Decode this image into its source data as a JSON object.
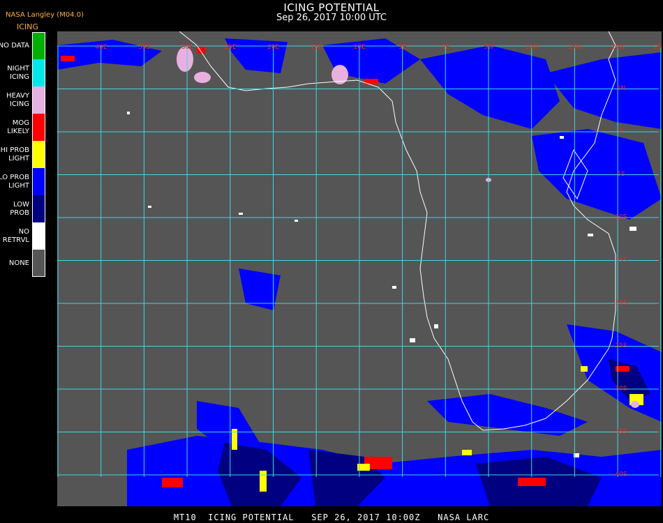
{
  "header": {
    "title": "ICING POTENTIAL",
    "subtitle": "Sep 26, 2017 10:00 UTC",
    "org": "NASA Langley (M04.0)",
    "product": "ICING"
  },
  "legend": [
    {
      "label": "NO DATA",
      "color": "#00b000"
    },
    {
      "label": "NIGHT\nICING",
      "color": "#00e8e8"
    },
    {
      "label": "HEAVY\nICING",
      "color": "#e8b0e0"
    },
    {
      "label": "MOG\nLIKELY",
      "color": "#ff0000"
    },
    {
      "label": "HI PROB\nLIGHT",
      "color": "#ffff00"
    },
    {
      "label": "LO PROB\nLIGHT",
      "color": "#0000ff"
    },
    {
      "label": "LOW\nPROB",
      "color": "#000080"
    },
    {
      "label": "NO\nRETRVL",
      "color": "#ffffff"
    },
    {
      "label": "NONE",
      "color": "#555555"
    }
  ],
  "map": {
    "background_color": "#555555",
    "grid_color": "#40d8e0",
    "coastline_color": "#ffffff",
    "top_labels": [
      "40E",
      "35E",
      "30E",
      "25E",
      "20E",
      "15E",
      "10E",
      "5E",
      "0E",
      "5W",
      "10W",
      "15W",
      "20W",
      "25W",
      "30W"
    ],
    "right_labels": [
      "5N",
      "0",
      "5S",
      "10S",
      "15S",
      "20S",
      "25S",
      "30S",
      "35S",
      "40S"
    ],
    "label_color": "#e83020"
  },
  "footer": "MT10  ICING POTENTIAL   SEP 26, 2017 10:00Z   NASA LARC"
}
